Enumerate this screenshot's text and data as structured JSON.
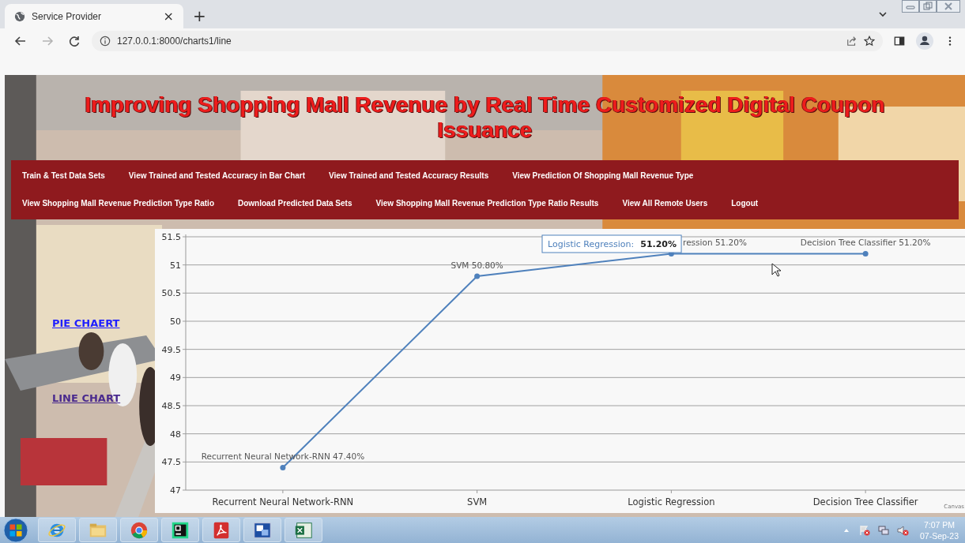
{
  "browser": {
    "tab": {
      "title": "Service Provider",
      "close": "×"
    },
    "new_tab": "+",
    "nav_buttons": [
      {
        "kind": "back",
        "disabled": false
      },
      {
        "kind": "forward",
        "disabled": true
      },
      {
        "kind": "reload",
        "disabled": false
      }
    ],
    "address": "127.0.0.1:8000/charts1/line"
  },
  "page": {
    "title": "Improving Shopping Mall Revenue by Real Time Customized Digital Coupon Issuance",
    "menu": [
      [
        {
          "label": "Train & Test Data Sets"
        },
        {
          "label": "View Trained and Tested Accuracy in Bar Chart"
        },
        {
          "label": "View Trained and Tested Accuracy Results"
        },
        {
          "label": "View Prediction Of Shopping Mall Revenue Type"
        }
      ],
      [
        {
          "label": "View Shopping Mall Revenue Prediction Type Ratio"
        },
        {
          "label": "Download Predicted Data Sets"
        },
        {
          "label": "View Shopping Mall Revenue Prediction Type Ratio Results"
        },
        {
          "label": "View All Remote Users"
        },
        {
          "label": "Logout"
        }
      ]
    ],
    "side_links": [
      {
        "label": "PIE CHAERT",
        "visited": false
      },
      {
        "label": "LINE CHART",
        "visited": true
      }
    ],
    "chart": {
      "chart_data": {
        "type": "line",
        "categories": [
          "Recurrent Neural Network-RNN",
          "SVM",
          "Logistic Regression",
          "Decision Tree Classifier"
        ],
        "series": [
          {
            "color": "#4f81bc",
            "marker": "circle",
            "values": [
              47.4,
              50.8,
              51.2,
              51.2
            ]
          }
        ],
        "grid": true,
        "ylim": [
          47,
          51.5
        ],
        "yticks": [
          47,
          47.5,
          48,
          48.5,
          49,
          49.5,
          50,
          50.5,
          51,
          51.5
        ],
        "value_labels": [
          "Recurrent Neural Network-RNN 47.40%",
          "SVM 50.80%",
          "ression 51.20%",
          "Decision Tree Classifier 51.20%"
        ]
      },
      "tooltip": {
        "label": "Logistic Regression:",
        "value": "51.20%"
      },
      "credit": "Canvas"
    }
  },
  "taskbar": {
    "apps": [
      {
        "kind": "ie"
      },
      {
        "kind": "folder"
      },
      {
        "kind": "chrome"
      },
      {
        "kind": "pycharm"
      },
      {
        "kind": "acrobat"
      },
      {
        "kind": "window-app"
      },
      {
        "kind": "excel"
      }
    ],
    "tray": [
      {
        "kind": "flag"
      },
      {
        "kind": "network"
      },
      {
        "kind": "speaker-muted"
      }
    ],
    "clock": {
      "time": "7:07 PM",
      "date": "07-Sep-23"
    }
  }
}
